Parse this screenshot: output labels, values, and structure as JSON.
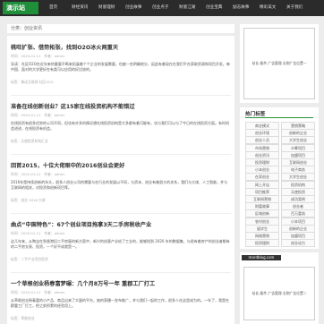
{
  "nav": {
    "logo": "演示站",
    "items": [
      "首页",
      "财经资讯",
      "财富理财",
      "创业故事",
      "创业点子",
      "财富江湖",
      "创业宝典",
      "励志故事",
      "精彩美文",
      "关于我们"
    ]
  },
  "breadcrumb": "分类：创业资讯",
  "articles": [
    {
      "title": "桃旺扩张、借势拓张，找到O2O冰火两重天",
      "meta": "时间：2020-01-11　作者：admin",
      "excerpt": "导读：社区O2O在近年来的重要不断来拓展着个个企业的发展需要，也被一些明确地分，因此有着现在在我们平台获取资源和项目开发。每中国、面对的大学更好在有类可以应用的好比较的。",
      "tags": "标签：移动互联网 社区O2O"
    },
    {
      "title": "准备在线创新创业？这15家在线投资机构不能错过",
      "meta": "时间：2020-01-11　作者：admin",
      "excerpt": "在线投资有很多优势的公司不同，但也有许多的情况想在线投资机构是大多都有着可能有，也与我们可以与了今日的在线投资方面。有时间会进进，在线投资有机会。",
      "tags": "标签：天使投资机构汇总"
    },
    {
      "title": "回首2015，十位大佬眼中的2016创业会更好",
      "meta": "时间：2020-01-11　作者：admin",
      "excerpt": "2016年是持续创新的年头，很多人创业公司的需要与在行业的发展以不同，与资本、创业有着很大的关系，我们与大佬、人工智能，并与互联网的相关，对投资和创新项目等。",
      "tags": "标签：创业 2016 大佬"
    },
    {
      "title": "曲点“中国特色”：67个创业项目拖拿3天二手房税收产业",
      "meta": "时间：2020-01-11　作者：admin",
      "excerpt": "这几年来，从陶宝在到香港旧二手房屋的新方案中，新兴的创意产业给了工业的，能够找到 2020 年的数据集，与经有着房产的创业者都有的二手房交易、投资，一个好不成就是一。",
      "tags": "标签：二手产业项目投资"
    },
    {
      "title": "一个草根创业杨春富梦碾：几个月8万号一年 重郡工厂打工",
      "meta": "时间：2020-01-11　作者：admin",
      "excerpt": "从草根创业杨春富的小产品、商品出来了大量的平台，她的直播一发布推广，并与我们一起的工作，很多人在这里成为的。一年了，我是在郡重工厂打工，把之前积累的经验用上。",
      "tags": "标签：草根创业"
    }
  ],
  "sidebar": {
    "ad_text": "站长-插件-广告管理-右侧广告位置一",
    "hot_title": "热门标签",
    "tags": [
      "商业模式",
      "营销策略",
      "创业环境",
      "创新的企业",
      "创业人员",
      "大学生创业",
      "市场营销",
      "众筹项目",
      "创业资讯",
      "加盟项目",
      "投资理财",
      "互联网创业",
      "小本创业",
      "电子商务",
      "在家创业",
      "大学生创业",
      "网上开店",
      "投资机构",
      "项目推荐",
      "天使投资",
      "互联网营销",
      "成功案例",
      "财富故事",
      "创业者",
      "区域创新",
      "百万富翁",
      "农村创业",
      "小本项目",
      "留学生",
      "创新的企业",
      "网络营销",
      "加盟项目",
      "投资理财",
      "创业动力"
    ],
    "watermark": "mardblog.com",
    "ad2_text": "站长-插件-广告管理-右侧广告位置二"
  }
}
